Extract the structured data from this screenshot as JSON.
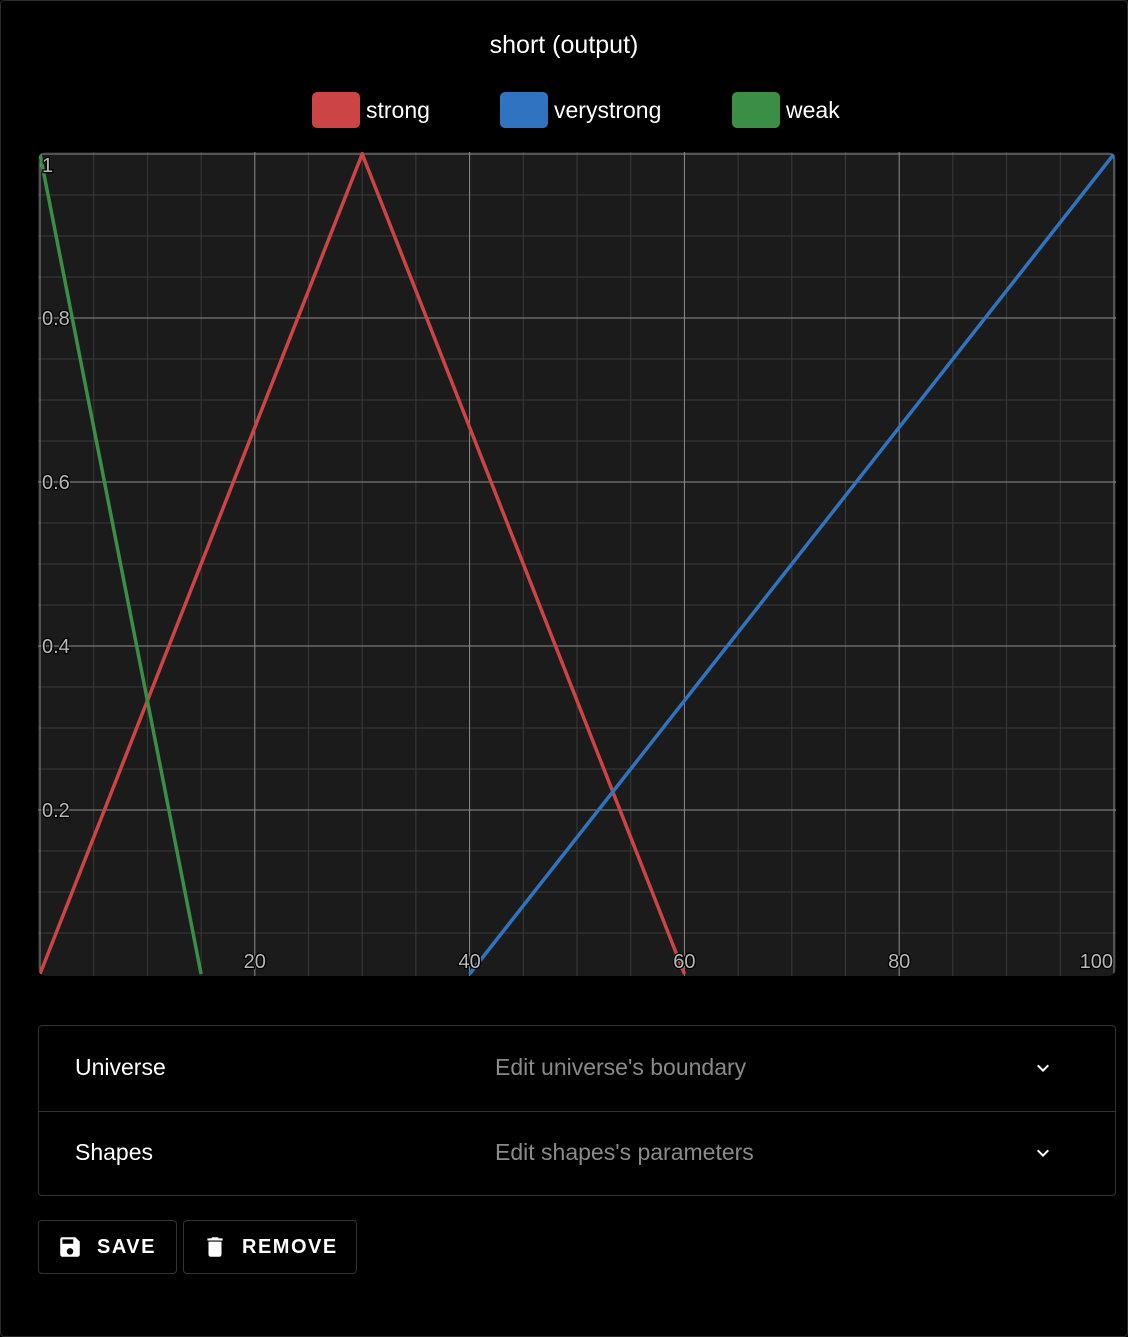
{
  "chart": {
    "title": "short (output)"
  },
  "chart_data": {
    "type": "line",
    "title": "short (output)",
    "xlabel": "",
    "ylabel": "",
    "xlim": [
      0,
      100
    ],
    "ylim": [
      0,
      1
    ],
    "x_ticks": [
      20,
      40,
      60,
      80,
      100
    ],
    "y_ticks": [
      0.2,
      0.4,
      0.6,
      0.8,
      1
    ],
    "x_tick_labels": [
      "20",
      "40",
      "60",
      "80",
      "100"
    ],
    "y_tick_labels": [
      "0.2",
      "0.4",
      "0.6",
      "0.8",
      "1"
    ],
    "grid": true,
    "legend_position": "top-center",
    "series": [
      {
        "name": "strong",
        "color": "#cc4444",
        "x": [
          0,
          30,
          60
        ],
        "y": [
          0,
          1,
          0
        ]
      },
      {
        "name": "verystrong",
        "color": "#2e74c0",
        "x": [
          40,
          100
        ],
        "y": [
          0,
          1
        ]
      },
      {
        "name": "weak",
        "color": "#3a8f44",
        "x": [
          0,
          15
        ],
        "y": [
          1,
          0
        ]
      }
    ]
  },
  "accordion": [
    {
      "title": "Universe",
      "subtitle": "Edit universe's boundary",
      "icon": "chevron-down-icon"
    },
    {
      "title": "Shapes",
      "subtitle": "Edit shapes's parameters",
      "icon": "chevron-down-icon"
    }
  ],
  "actions": {
    "save_label": "SAVE",
    "save_icon": "floppy-disk-icon",
    "remove_label": "REMOVE",
    "remove_icon": "trash-icon"
  }
}
